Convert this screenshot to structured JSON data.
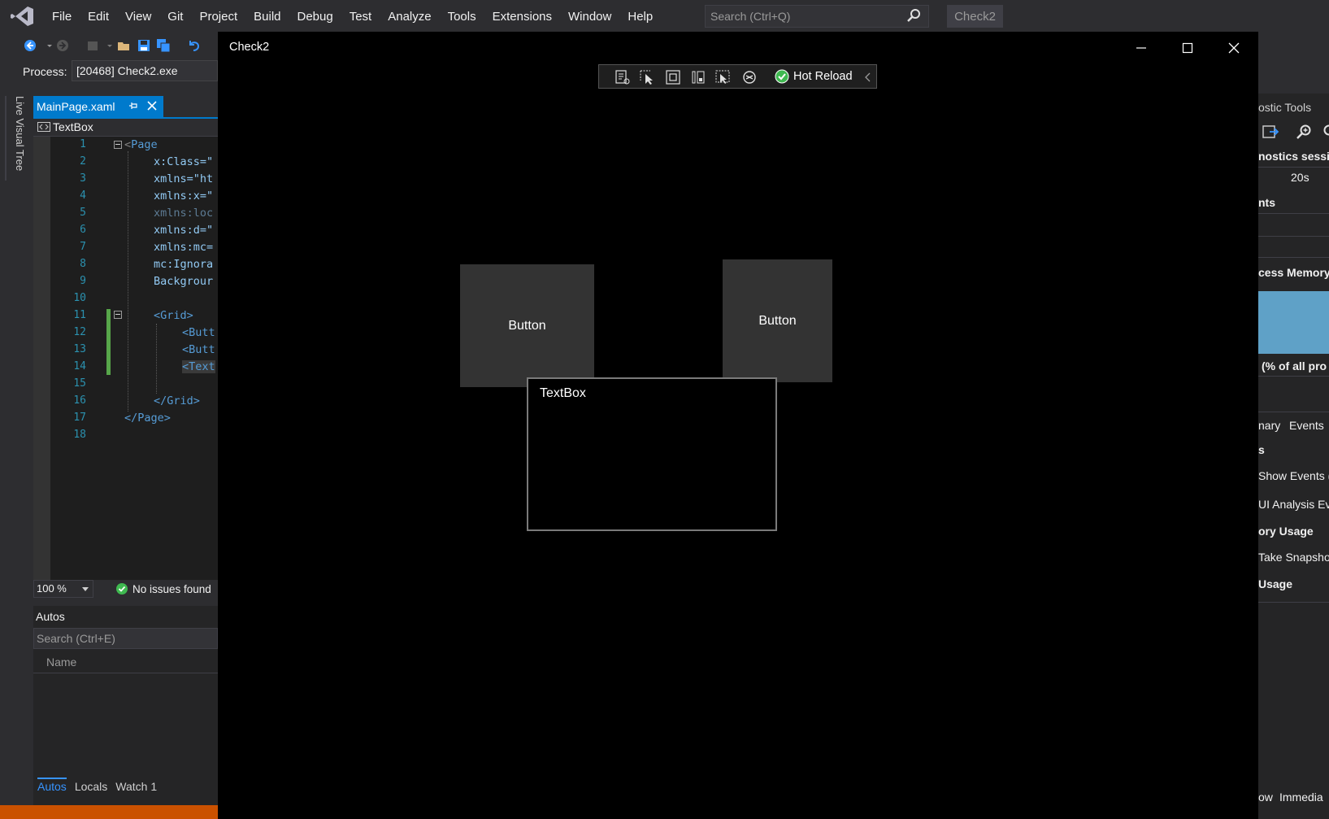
{
  "menubar": {
    "items": [
      "File",
      "Edit",
      "View",
      "Git",
      "Project",
      "Build",
      "Debug",
      "Test",
      "Analyze",
      "Tools",
      "Extensions",
      "Window",
      "Help"
    ],
    "search_placeholder": "Search (Ctrl+Q)",
    "solution_name": "Check2"
  },
  "toolbar": {
    "process_label": "Process:",
    "process_value": "[20468] Check2.exe"
  },
  "side_tab": {
    "label": "Live Visual Tree"
  },
  "editor": {
    "tab_label": "MainPage.xaml",
    "nav_label": "TextBox",
    "line_numbers": [
      "1",
      "2",
      "3",
      "4",
      "5",
      "6",
      "7",
      "8",
      "9",
      "10",
      "11",
      "12",
      "13",
      "14",
      "15",
      "16",
      "17",
      "18"
    ],
    "lines": [
      {
        "open": "<",
        "tag": "Page",
        "rest": ""
      },
      {
        "attr": "x:Class=\"",
        "rest": ""
      },
      {
        "attr": "xmlns=\"ht",
        "rest": ""
      },
      {
        "attr": "xmlns:x=\"",
        "rest": ""
      },
      {
        "attr": "xmlns:loc",
        "rest": ""
      },
      {
        "attr": "xmlns:d=\"",
        "rest": ""
      },
      {
        "attr": "xmlns:mc=",
        "rest": ""
      },
      {
        "attr": "mc:Ignora",
        "rest": ""
      },
      {
        "attr": "Backgrour",
        "rest": ""
      },
      {
        "attr": "",
        "rest": ""
      },
      {
        "tag": "<Grid>",
        "rest": ""
      },
      {
        "tag": "<Butt",
        "rest": ""
      },
      {
        "tag": "<Butt",
        "rest": ""
      },
      {
        "tag": "<Text",
        "rest": ""
      },
      {
        "tag": "",
        "rest": ""
      },
      {
        "tag": "</Grid>",
        "rest": ""
      },
      {
        "tag": "</Page>",
        "rest": ""
      },
      {
        "tag": "",
        "rest": ""
      }
    ],
    "zoom": "100 %",
    "issues": "No issues found"
  },
  "autos": {
    "title": "Autos",
    "search_placeholder": "Search (Ctrl+E)",
    "column_name": "Name",
    "tabs": [
      "Autos",
      "Locals",
      "Watch 1"
    ]
  },
  "app_window": {
    "title": "Check2",
    "hot_reload_label": "Hot Reload",
    "button_1_label": "Button",
    "button_2_label": "Button",
    "textbox_value": "TextBox"
  },
  "diagnostics": {
    "title": "ostic Tools",
    "session": "nostics sessio",
    "timeline": "20s",
    "events": "nts",
    "memory": "cess Memory",
    "cpu": "(% of all pro",
    "tab_summary": "nary",
    "tab_events": "Events",
    "events_section": "s",
    "show_events": "Show Events (",
    "ui_analysis": "UI Analysis Ev",
    "memory_usage": "ory Usage",
    "take_snapshot": "Take Snapsho",
    "usage": "Usage",
    "bottom_tab_1": "ow",
    "bottom_tab_2": "Immedia"
  },
  "colors": {
    "accent": "#007acc",
    "status_orange": "#ca5100",
    "memory_graph": "#5fa1c7",
    "hot_reload_ok": "#3fb950"
  }
}
